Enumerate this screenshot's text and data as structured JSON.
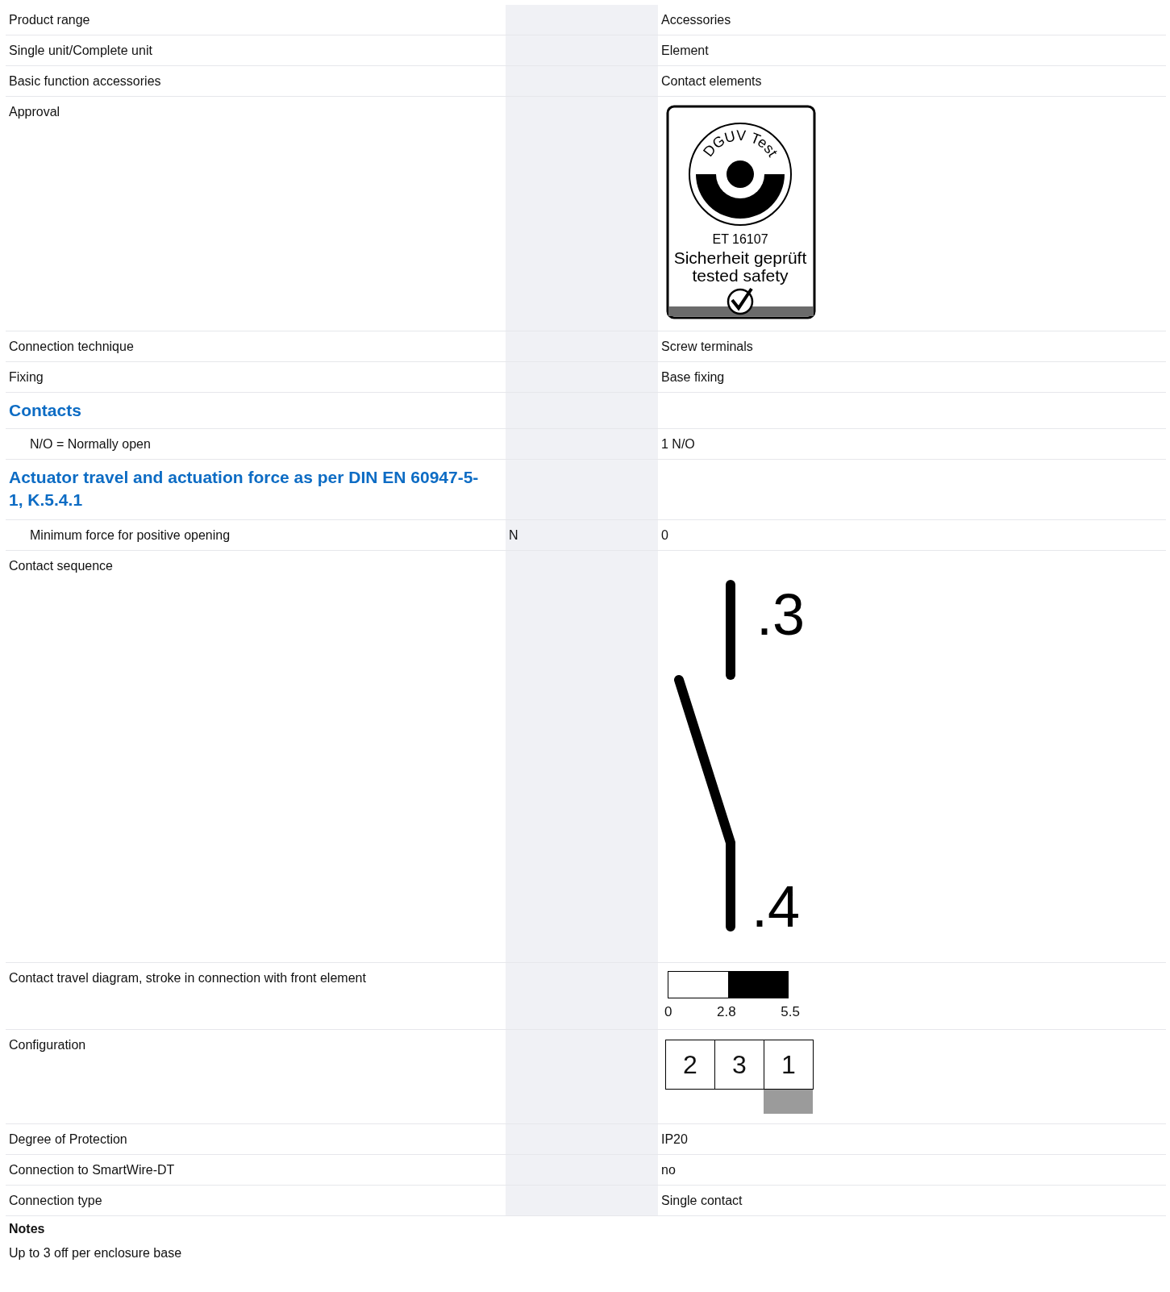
{
  "rows": [
    {
      "kind": "text",
      "label": "Product range",
      "unit": "",
      "value": "Accessories"
    },
    {
      "kind": "text",
      "label": "Single unit/Complete unit",
      "unit": "",
      "value": "Element"
    },
    {
      "kind": "text",
      "label": "Basic function accessories",
      "unit": "",
      "value": "Contact elements"
    },
    {
      "kind": "approval",
      "label": "Approval",
      "badge": {
        "ring": "DGUV Test",
        "number": "ET 16107",
        "line_1": "Sicherheit geprüft",
        "line_2": "tested safety"
      }
    },
    {
      "kind": "text",
      "label": "Connection technique",
      "unit": "",
      "value": "Screw terminals"
    },
    {
      "kind": "text",
      "label": "Fixing",
      "unit": "",
      "value": "Base fixing"
    },
    {
      "kind": "heading",
      "label": "Contacts"
    },
    {
      "kind": "sub",
      "label": "N/O = Normally open",
      "unit": "",
      "value": "1 N/O"
    },
    {
      "kind": "heading",
      "label": "Actuator travel and actuation force as per DIN EN 60947-5-1, K.5.4.1"
    },
    {
      "kind": "sub",
      "label": "Minimum force for positive opening",
      "unit": "N",
      "value": "0"
    },
    {
      "kind": "sequence",
      "label": "Contact sequence",
      "top": ".3",
      "bottom": ".4"
    },
    {
      "kind": "travel",
      "label": "Contact travel diagram, stroke in connection with front element",
      "ticks": [
        "0",
        "2.8",
        "5.5"
      ],
      "segments": [
        {
          "closed": false
        },
        {
          "closed": true
        }
      ]
    },
    {
      "kind": "config",
      "label": "Configuration",
      "cells": [
        {
          "label": "2",
          "selected": false
        },
        {
          "label": "3",
          "selected": false
        },
        {
          "label": "1",
          "selected": true
        }
      ]
    },
    {
      "kind": "text",
      "label": "Degree of Protection",
      "unit": "",
      "value": "IP20"
    },
    {
      "kind": "text",
      "label": "Connection to SmartWire-DT",
      "unit": "",
      "value": "no"
    },
    {
      "kind": "text",
      "label": "Connection type",
      "unit": "",
      "value": "Single contact"
    }
  ],
  "notes": {
    "title": "Notes",
    "text": "Up to 3 off per enclosure base"
  }
}
